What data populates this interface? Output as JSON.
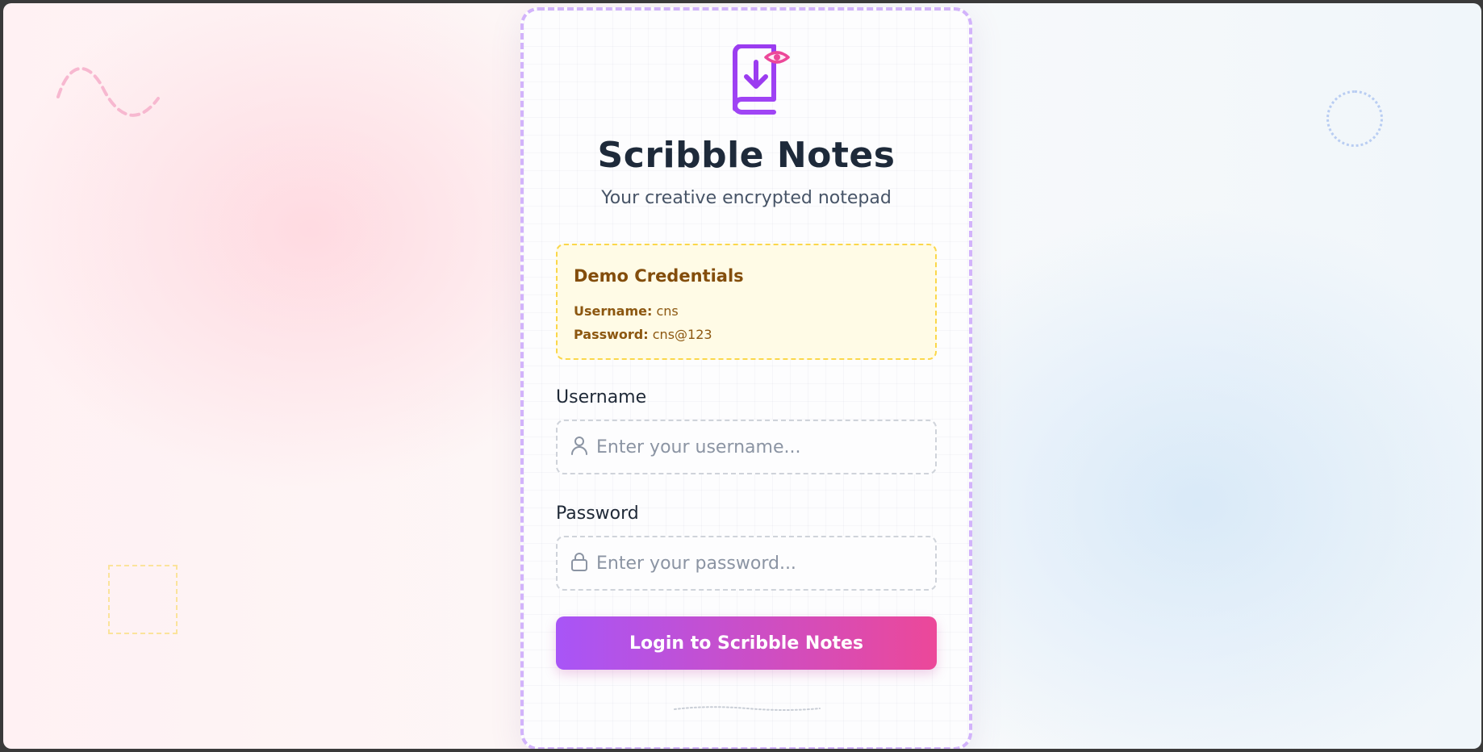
{
  "app": {
    "title": "Scribble Notes",
    "subtitle": "Your creative encrypted notepad"
  },
  "demo": {
    "title": "Demo Credentials",
    "username_key": "Username:",
    "username_value": "cns",
    "password_key": "Password:",
    "password_value": "cns@123"
  },
  "form": {
    "username_label": "Username",
    "username_placeholder": "Enter your username...",
    "username_value": "",
    "password_label": "Password",
    "password_placeholder": "Enter your password...",
    "password_value": "",
    "submit_label": "Login to Scribble Notes"
  },
  "icons": {
    "logo": "book-download-eye-icon",
    "username": "user-icon",
    "password": "lock-icon"
  },
  "colors": {
    "accent_start": "#a855f7",
    "accent_end": "#ec4899",
    "card_border": "#d2b3fb",
    "demo_bg": "#fffbe6",
    "demo_border": "#fbd74a",
    "title": "#1e2a3a"
  }
}
